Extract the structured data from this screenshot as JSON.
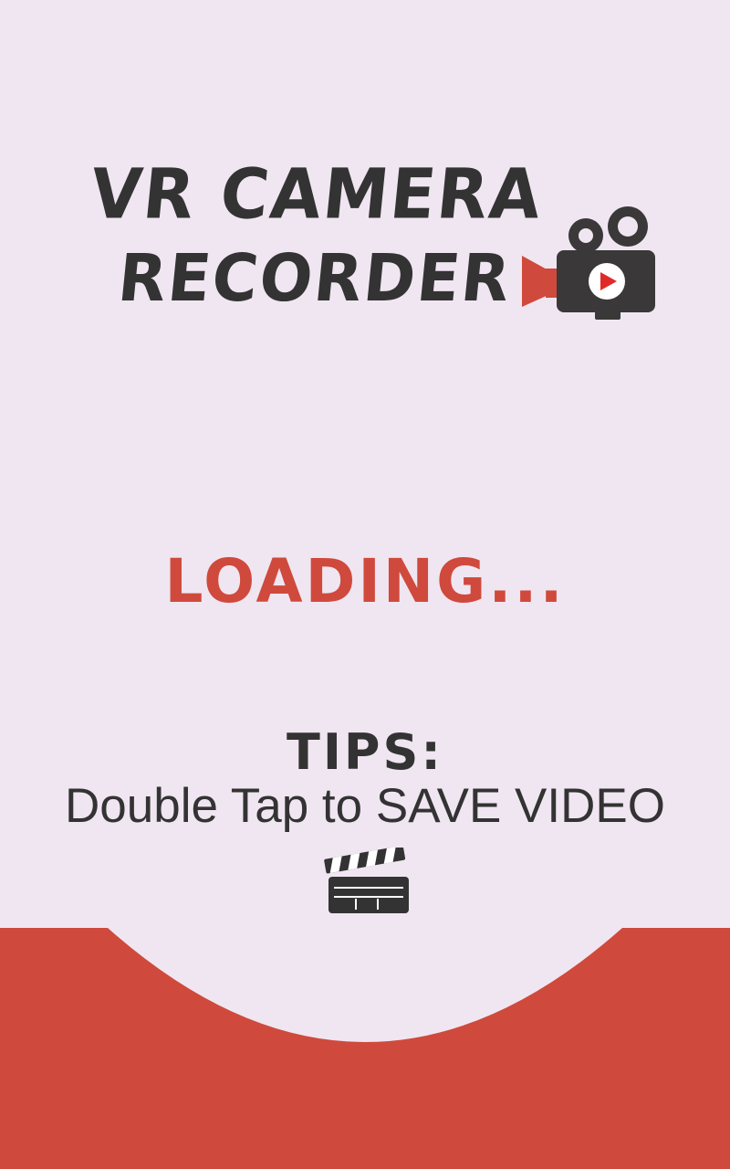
{
  "splash": {
    "title_line_1": "VR CAMERA",
    "title_line_2": "RECORDER",
    "loading": "LOADING...",
    "tips_label": "TIPS:",
    "tips_text": "Double Tap to SAVE VIDEO"
  },
  "icons": {
    "logo": "video-camera-icon",
    "tip": "clapperboard-icon"
  },
  "colors": {
    "background": "#f0e6f1",
    "accent_red": "#cf4a3c",
    "dark_text": "#333333"
  }
}
